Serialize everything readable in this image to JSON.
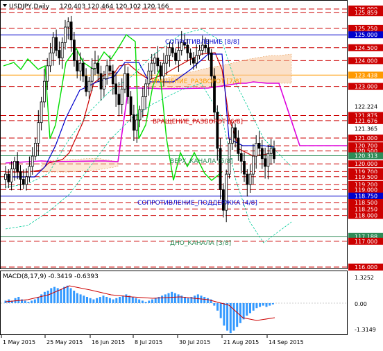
{
  "header": {
    "symbol_label": "USDJPY,Daily",
    "ohlc": "120.403 120.464 120.102 120.166"
  },
  "macd": {
    "label": "MACD(8,17,9) -0.3419 -0.6393",
    "scale_top": "1.3252",
    "scale_zero": "0.00",
    "scale_bottom": "-1.3149"
  },
  "price_labels": [
    {
      "text": "126.000",
      "value": 126.0,
      "bg": "#cc0000"
    },
    {
      "text": "125.859",
      "value": 125.859,
      "bg": "#cc0000"
    },
    {
      "text": "125.250",
      "value": 125.25,
      "bg": "#cc0000"
    },
    {
      "text": "125.000",
      "value": 125.0,
      "bg": "#0000cc"
    },
    {
      "text": "124.500",
      "value": 124.5,
      "bg": "#cc0000"
    },
    {
      "text": "124.000",
      "value": 124.0,
      "bg": "#cc0000"
    },
    {
      "text": "123.438",
      "value": 123.438,
      "bg": "#ff9900"
    },
    {
      "text": "123.000",
      "value": 123.0,
      "bg": "#cc0000"
    },
    {
      "text": "122.224",
      "value": 122.224,
      "bg": null
    },
    {
      "text": "121.875",
      "value": 121.875,
      "bg": "#cc0000"
    },
    {
      "text": "121.676",
      "value": 121.676,
      "bg": "#cc0000"
    },
    {
      "text": "121.365",
      "value": 121.365,
      "bg": null
    },
    {
      "text": "121.000",
      "value": 121.0,
      "bg": "#cc0000"
    },
    {
      "text": "120.700",
      "value": 120.7,
      "bg": "#cc0000"
    },
    {
      "text": "120.500",
      "value": 120.5,
      "bg": "#cc0000"
    },
    {
      "text": "120.313",
      "value": 120.313,
      "bg": "#2e8b57"
    },
    {
      "text": "120.000",
      "value": 120.0,
      "bg": "#cc0000"
    },
    {
      "text": "119.700",
      "value": 119.7,
      "bg": "#cc0000"
    },
    {
      "text": "119.500",
      "value": 119.5,
      "bg": "#cc0000"
    },
    {
      "text": "119.200",
      "value": 119.2,
      "bg": "#cc0000"
    },
    {
      "text": "119.000",
      "value": 119.0,
      "bg": "#cc0000"
    },
    {
      "text": "118.750",
      "value": 118.75,
      "bg": "#0000cc"
    },
    {
      "text": "118.500",
      "value": 118.5,
      "bg": "#cc0000"
    },
    {
      "text": "118.250",
      "value": 118.25,
      "bg": "#cc0000"
    },
    {
      "text": "118.000",
      "value": 118.0,
      "bg": "#cc0000"
    },
    {
      "text": "117.188",
      "value": 117.188,
      "bg": "#2e8b57"
    },
    {
      "text": "117.000",
      "value": 117.0,
      "bg": "#cc0000"
    },
    {
      "text": "116.000",
      "value": 116.0,
      "bg": "#cc0000"
    }
  ],
  "annotations": [
    {
      "text": "СОПРОТИВЛЕНИЕ [8/8]",
      "color": "#0000cc"
    },
    {
      "text": "ВРАЩЕНИЕ_РАЗВОРОТ [6/8]",
      "color": "#cc0000"
    },
    {
      "text": "ВЕРХ_КАНАЛА [5/8]",
      "color": "#2e8b57"
    },
    {
      "text": "СОПРОТИВЛЕНИЕ_ПОДДЕРЖКА [4/8]",
      "color": "#0000cc"
    },
    {
      "text": "ДНО_КАНАЛА [3/8]",
      "color": "#2e8b57"
    },
    {
      "text": "ВРАЩЕНИЕ_РАЗВОРОТ [7/8]",
      "color": "#ff9900"
    }
  ],
  "time_labels": [
    "1 May 2015",
    "25 May 2015",
    "16 Jun 2015",
    "8 Jul 2015",
    "30 Jul 2015",
    "21 Aug 2015",
    "14 Sep 2015"
  ],
  "colors": {
    "level_red": "#cc0000",
    "level_blue": "#0000cc",
    "level_green": "#2e8b57",
    "candle": "#000000",
    "tenkan": "#cc0000",
    "kijun": "#0000cc",
    "senkou_b": "#dd00dd",
    "chikou": "#00dd00",
    "histogram": "#3399ff",
    "signal": "#cc0000",
    "envelope": "#00cc99"
  }
}
